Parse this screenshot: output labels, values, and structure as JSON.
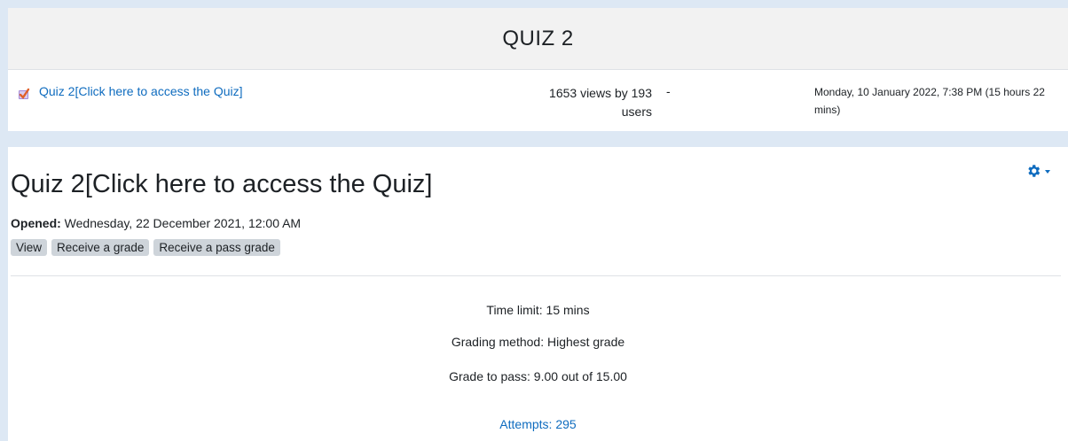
{
  "report": {
    "title": "QUIZ 2",
    "activity_link": "Quiz 2[Click here to access the Quiz]",
    "views_line1": "1653 views by 193",
    "views_line2": "users",
    "separator": "-",
    "last_access": "Monday, 10 January 2022, 7:38 PM (15 hours 22 mins)"
  },
  "activity": {
    "title": "Quiz 2[Click here to access the Quiz]",
    "opened_label": "Opened:",
    "opened_value": " Wednesday, 22 December 2021, 12:00 AM",
    "completion": [
      "View",
      "Receive a grade",
      "Receive a pass grade"
    ],
    "time_limit": "Time limit: 15 mins",
    "grading_method": "Grading method: Highest grade",
    "grade_to_pass": "Grade to pass: 9.00 out of 15.00",
    "attempts": "Attempts: 295"
  },
  "colors": {
    "link": "#0f6cbf",
    "page_bg": "#dde8f4",
    "header_bg": "#f2f2f2",
    "badge_bg": "#ced4da"
  },
  "icons": {
    "quiz": "quiz-icon",
    "actions": "gear-icon"
  }
}
